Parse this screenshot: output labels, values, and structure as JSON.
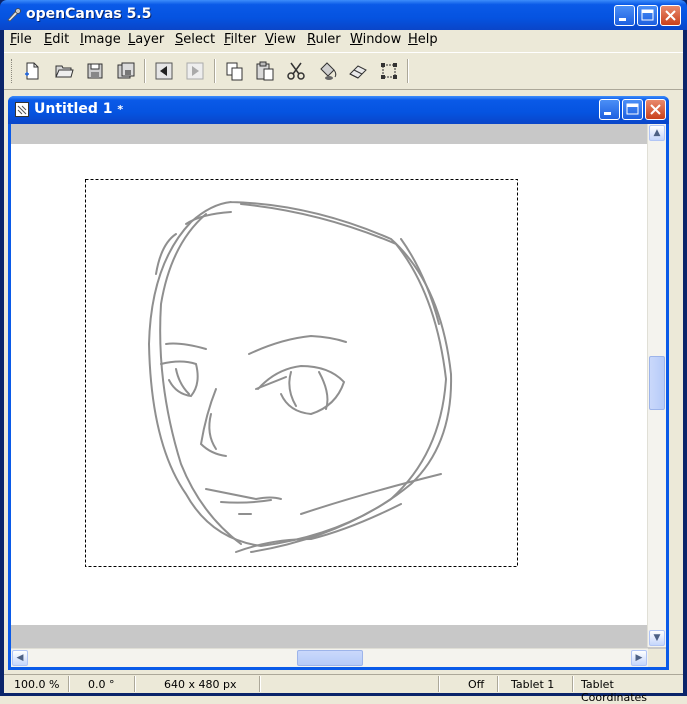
{
  "app": {
    "title": "openCanvas 5.5"
  },
  "menu": [
    {
      "label": "File",
      "key": "F",
      "rest": "ile"
    },
    {
      "label": "Edit",
      "key": "E",
      "rest": "dit"
    },
    {
      "label": "Image",
      "key": "I",
      "rest": "mage"
    },
    {
      "label": "Layer",
      "key": "L",
      "rest": "ayer"
    },
    {
      "label": "Select",
      "key": "S",
      "rest": "elect"
    },
    {
      "label": "Filter",
      "key": "F",
      "rest": "ilter"
    },
    {
      "label": "View",
      "key": "V",
      "rest": "iew"
    },
    {
      "label": "Ruler",
      "key": "R",
      "rest": "uler"
    },
    {
      "label": "Window",
      "key": "W",
      "rest": "indow"
    },
    {
      "label": "Help",
      "key": "H",
      "rest": "elp"
    }
  ],
  "toolbar": {
    "icons": [
      "new-file-icon",
      "open-folder-icon",
      "save-icon",
      "save-all-icon",
      "undo-arrow-icon",
      "redo-arrow-icon",
      "copy-icon",
      "paste-icon",
      "cut-scissors-icon",
      "fill-bucket-icon",
      "eraser-icon",
      "transform-icon"
    ]
  },
  "document": {
    "title": "Untitled 1",
    "modified_marker": "*"
  },
  "status": {
    "zoom": "100.0 %",
    "rotation": "0.0 °",
    "size": "640 x 480 px",
    "mode": "Off",
    "tablet": "Tablet 1",
    "coords": "Tablet Coordinates"
  },
  "colors": {
    "titlebar": "#0553e0",
    "frame": "#ece9d8",
    "sketch_stroke": "#8f8f8f"
  }
}
